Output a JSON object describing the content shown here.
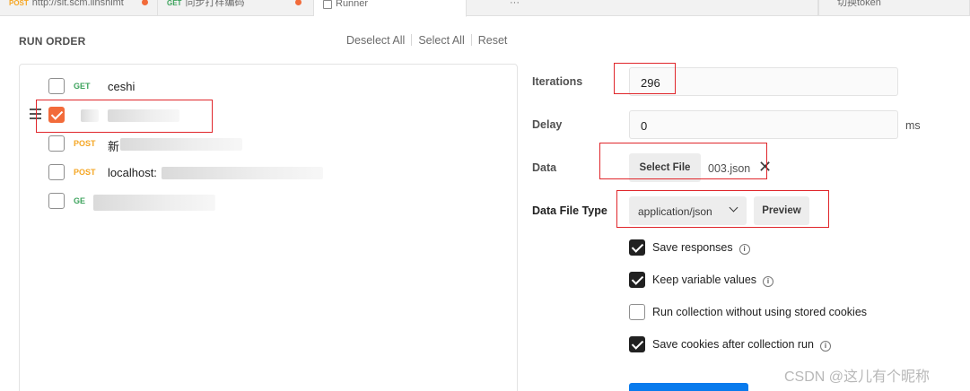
{
  "tabs": [
    {
      "method": "POST",
      "title": "http://sit.scm.linshimt"
    },
    {
      "method": "GET",
      "title": "同步打样编码"
    },
    {
      "title": "Runner"
    },
    {
      "title": "···"
    },
    {
      "title": "切换token"
    }
  ],
  "run_order": {
    "heading": "RUN ORDER",
    "deselect_all": "Deselect All",
    "select_all": "Select All",
    "reset": "Reset"
  },
  "requests": [
    {
      "method": "GET",
      "name": "ceshi",
      "checked": false
    },
    {
      "method": "",
      "name": "",
      "checked": true
    },
    {
      "method": "POST",
      "name": "新",
      "checked": false
    },
    {
      "method": "POST",
      "name": "localhost:",
      "checked": false
    },
    {
      "method": "GE",
      "name": "",
      "checked": false
    }
  ],
  "settings": {
    "iterations_label": "Iterations",
    "iterations_value": "296",
    "delay_label": "Delay",
    "delay_value": "0",
    "delay_unit": "ms",
    "data_label": "Data",
    "select_file": "Select File",
    "file_name": "003.json",
    "data_file_type_label": "Data File Type",
    "data_file_type_value": "application/json",
    "preview": "Preview"
  },
  "options": [
    {
      "label": "Save responses",
      "checked": true,
      "info": true
    },
    {
      "label": "Keep variable values",
      "checked": true,
      "info": true
    },
    {
      "label": "Run collection without using stored cookies",
      "checked": false,
      "info": false
    },
    {
      "label": "Save cookies after collection run",
      "checked": true,
      "info": true
    }
  ],
  "watermark": "CSDN @这儿有个昵称",
  "colors": {
    "accent": "#f26b3a",
    "get": "#3da35d",
    "post": "#f5a623",
    "highlight": "#e0262b",
    "run_button": "#097bed"
  }
}
